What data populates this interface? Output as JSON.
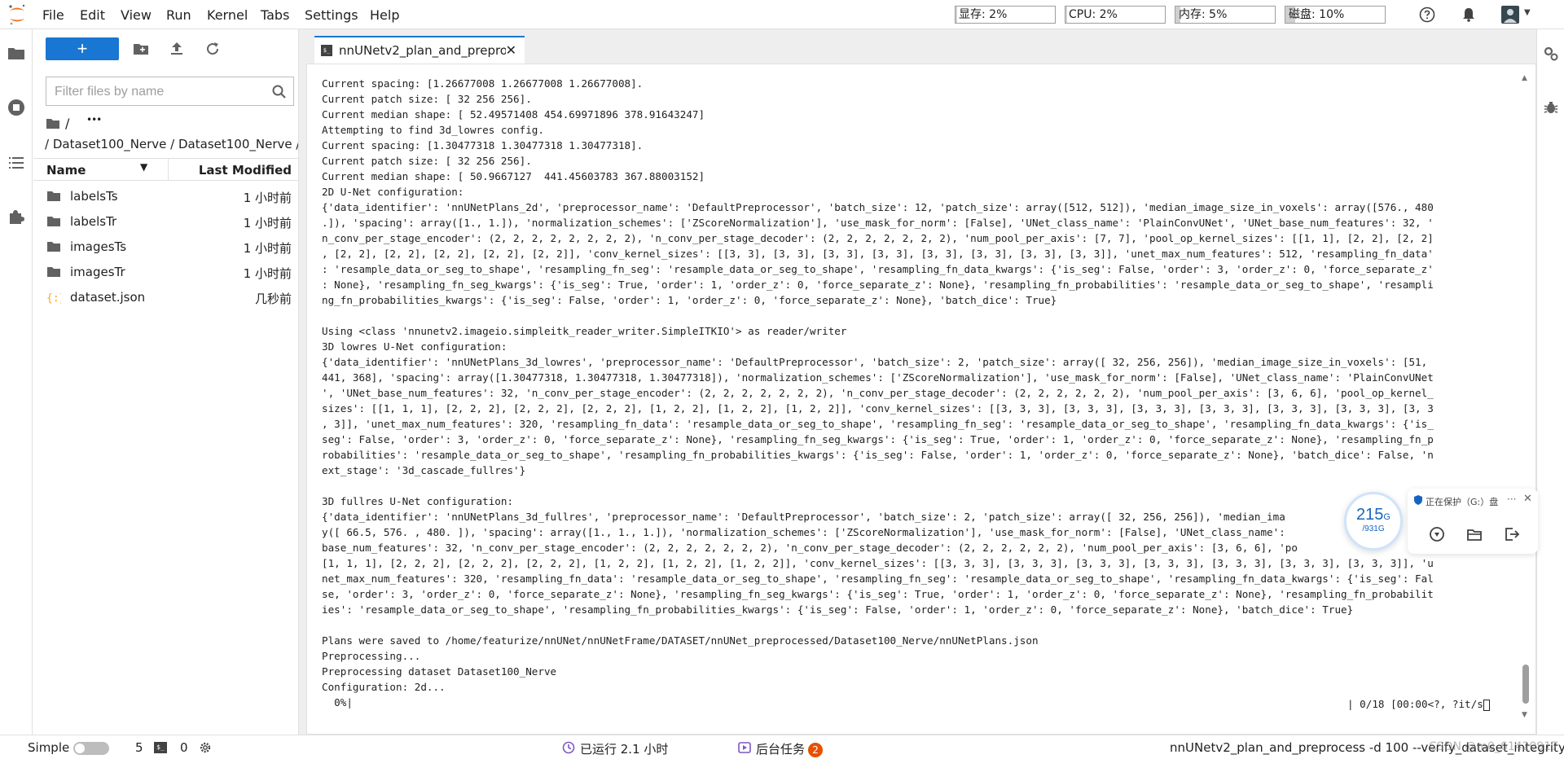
{
  "menubar": {
    "items": [
      "File",
      "Edit",
      "View",
      "Run",
      "Kernel",
      "Tabs",
      "Settings",
      "Help"
    ],
    "meters": [
      {
        "label": "显存: 2%",
        "value_percent": 2
      },
      {
        "label": "CPU: 2%",
        "value_percent": 2
      },
      {
        "label": "内存: 5%",
        "value_percent": 5
      },
      {
        "label": "磁盘: 10%",
        "value_percent": 10
      }
    ],
    "icons": [
      "help-icon",
      "bell-icon",
      "avatar"
    ]
  },
  "leftbar": {
    "icons": [
      "folder-icon",
      "running-icon",
      "toc-icon",
      "extension-icon"
    ]
  },
  "filebrowser": {
    "new_label": "+",
    "filter_placeholder": "Filter files by name",
    "breadcrumb_root": "/",
    "breadcrumb_more": "•••",
    "breadcrumb_path": "/ Dataset100_Nerve / Dataset100_Nerve /",
    "header_name": "Name",
    "header_modified": "Last Modified",
    "files": [
      {
        "name": "labelsTs",
        "type": "folder",
        "modified": "1 小时前"
      },
      {
        "name": "labelsTr",
        "type": "folder",
        "modified": "1 小时前"
      },
      {
        "name": "imagesTs",
        "type": "folder",
        "modified": "1 小时前"
      },
      {
        "name": "imagesTr",
        "type": "folder",
        "modified": "1 小时前"
      },
      {
        "name": "dataset.json",
        "type": "json",
        "modified": "几秒前"
      }
    ]
  },
  "tab": {
    "icon_label": "$_",
    "label": "nnUNetv2_plan_and_preprocess",
    "close": "✕"
  },
  "terminal": {
    "text": "Current spacing: [1.26677008 1.26677008 1.26677008].\nCurrent patch size: [ 32 256 256].\nCurrent median shape: [ 52.49571408 454.69971896 378.91643247]\nAttempting to find 3d_lowres config.\nCurrent spacing: [1.30477318 1.30477318 1.30477318].\nCurrent patch size: [ 32 256 256].\nCurrent median shape: [ 50.9667127  441.45603783 367.88003152]\n2D U-Net configuration:\n{'data_identifier': 'nnUNetPlans_2d', 'preprocessor_name': 'DefaultPreprocessor', 'batch_size': 12, 'patch_size': array([512, 512]), 'median_image_size_in_voxels': array([576., 480\n.]), 'spacing': array([1., 1.]), 'normalization_schemes': ['ZScoreNormalization'], 'use_mask_for_norm': [False], 'UNet_class_name': 'PlainConvUNet', 'UNet_base_num_features': 32, '\nn_conv_per_stage_encoder': (2, 2, 2, 2, 2, 2, 2, 2), 'n_conv_per_stage_decoder': (2, 2, 2, 2, 2, 2, 2), 'num_pool_per_axis': [7, 7], 'pool_op_kernel_sizes': [[1, 1], [2, 2], [2, 2]\n, [2, 2], [2, 2], [2, 2], [2, 2], [2, 2]], 'conv_kernel_sizes': [[3, 3], [3, 3], [3, 3], [3, 3], [3, 3], [3, 3], [3, 3], [3, 3]], 'unet_max_num_features': 512, 'resampling_fn_data'\n: 'resample_data_or_seg_to_shape', 'resampling_fn_seg': 'resample_data_or_seg_to_shape', 'resampling_fn_data_kwargs': {'is_seg': False, 'order': 3, 'order_z': 0, 'force_separate_z'\n: None}, 'resampling_fn_seg_kwargs': {'is_seg': True, 'order': 1, 'order_z': 0, 'force_separate_z': None}, 'resampling_fn_probabilities': 'resample_data_or_seg_to_shape', 'resampli\nng_fn_probabilities_kwargs': {'is_seg': False, 'order': 1, 'order_z': 0, 'force_separate_z': None}, 'batch_dice': True}\n\nUsing <class 'nnunetv2.imageio.simpleitk_reader_writer.SimpleITKIO'> as reader/writer\n3D lowres U-Net configuration:\n{'data_identifier': 'nnUNetPlans_3d_lowres', 'preprocessor_name': 'DefaultPreprocessor', 'batch_size': 2, 'patch_size': array([ 32, 256, 256]), 'median_image_size_in_voxels': [51,\n441, 368], 'spacing': array([1.30477318, 1.30477318, 1.30477318]), 'normalization_schemes': ['ZScoreNormalization'], 'use_mask_for_norm': [False], 'UNet_class_name': 'PlainConvUNet\n', 'UNet_base_num_features': 32, 'n_conv_per_stage_encoder': (2, 2, 2, 2, 2, 2, 2), 'n_conv_per_stage_decoder': (2, 2, 2, 2, 2, 2), 'num_pool_per_axis': [3, 6, 6], 'pool_op_kernel_\nsizes': [[1, 1, 1], [2, 2, 2], [2, 2, 2], [2, 2, 2], [1, 2, 2], [1, 2, 2], [1, 2, 2]], 'conv_kernel_sizes': [[3, 3, 3], [3, 3, 3], [3, 3, 3], [3, 3, 3], [3, 3, 3], [3, 3, 3], [3, 3\n, 3]], 'unet_max_num_features': 320, 'resampling_fn_data': 'resample_data_or_seg_to_shape', 'resampling_fn_seg': 'resample_data_or_seg_to_shape', 'resampling_fn_data_kwargs': {'is_\nseg': False, 'order': 3, 'order_z': 0, 'force_separate_z': None}, 'resampling_fn_seg_kwargs': {'is_seg': True, 'order': 1, 'order_z': 0, 'force_separate_z': None}, 'resampling_fn_p\nrobabilities': 'resample_data_or_seg_to_shape', 'resampling_fn_probabilities_kwargs': {'is_seg': False, 'order': 1, 'order_z': 0, 'force_separate_z': None}, 'batch_dice': False, 'n\next_stage': '3d_cascade_fullres'}\n\n3D fullres U-Net configuration:\n{'data_identifier': 'nnUNetPlans_3d_fullres', 'preprocessor_name': 'DefaultPreprocessor', 'batch_size': 2, 'patch_size': array([ 32, 256, 256]), 'median_ima\ny([ 66.5, 576. , 480. ]), 'spacing': array([1., 1., 1.]), 'normalization_schemes': ['ZScoreNormalization'], 'use_mask_for_norm': [False], 'UNet_class_name':\nbase_num_features': 32, 'n_conv_per_stage_encoder': (2, 2, 2, 2, 2, 2, 2), 'n_conv_per_stage_decoder': (2, 2, 2, 2, 2, 2), 'num_pool_per_axis': [3, 6, 6], 'po\n[1, 1, 1], [2, 2, 2], [2, 2, 2], [2, 2, 2], [1, 2, 2], [1, 2, 2], [1, 2, 2]], 'conv_kernel_sizes': [[3, 3, 3], [3, 3, 3], [3, 3, 3], [3, 3, 3], [3, 3, 3], [3, 3, 3], [3, 3, 3]], 'u\nnet_max_num_features': 320, 'resampling_fn_data': 'resample_data_or_seg_to_shape', 'resampling_fn_seg': 'resample_data_or_seg_to_shape', 'resampling_fn_data_kwargs': {'is_seg': Fal\nse, 'order': 3, 'order_z': 0, 'force_separate_z': None}, 'resampling_fn_seg_kwargs': {'is_seg': True, 'order': 1, 'order_z': 0, 'force_separate_z': None}, 'resampling_fn_probabilit\nies': 'resample_data_or_seg_to_shape', 'resampling_fn_probabilities_kwargs': {'is_seg': False, 'order': 1, 'order_z': 0, 'force_separate_z': None}, 'batch_dice': True}\n\nPlans were saved to /home/featurize/nnUNet/nnUNetFrame/DATASET/nnUNet_preprocessed/Dataset100_Nerve/nnUNetPlans.json\nPreprocessing...\nPreprocessing dataset Dataset100_Nerve\nConfiguration: 2d...\n  0%|",
    "progress_right": "| 0/18 [00:00<?, ?it/s"
  },
  "statusbar": {
    "mode_label": "Simple",
    "kernel_count": "5",
    "terminal_count": "0",
    "running_time": "已运行 2.1 小时",
    "background_tasks": "后台任务",
    "background_count": "2",
    "current_command": "nnUNetv2_plan_and_preprocess -d 100 --verify_dataset_integrity",
    "watermark": "CSDN @m0_61420917"
  },
  "disk_widget": {
    "used": "215",
    "used_unit": "G",
    "total": "/931G",
    "status": "正在保护（G:）盘",
    "more": "···",
    "close": "✕"
  },
  "colors": {
    "accent": "#1976d2",
    "badge": "#e65100",
    "logo": "#f37626"
  }
}
